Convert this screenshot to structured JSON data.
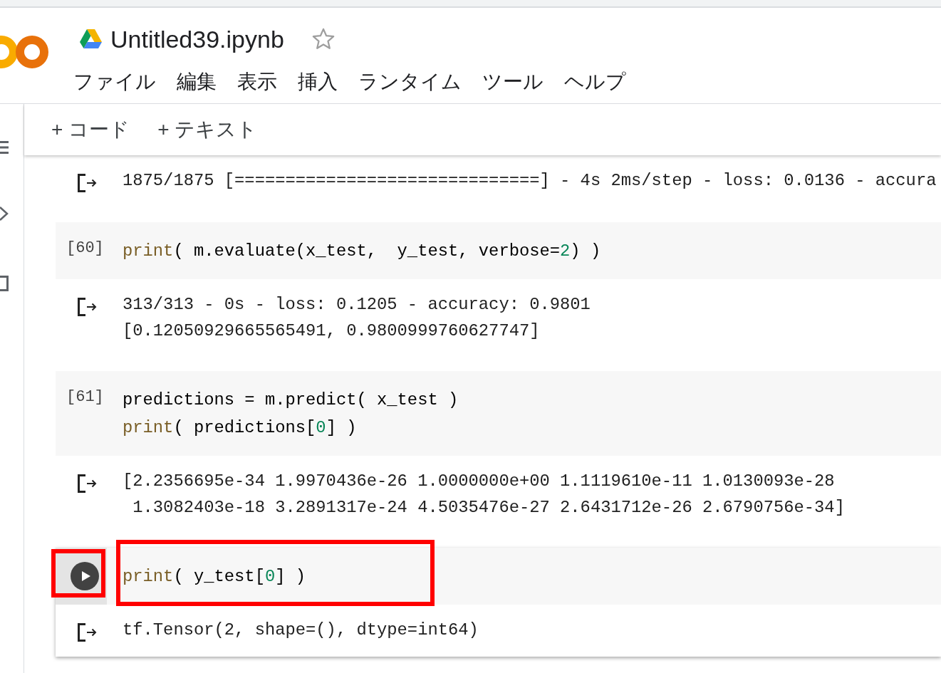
{
  "header": {
    "title": "Untitled39.ipynb",
    "starred": false,
    "menu": [
      "ファイル",
      "編集",
      "表示",
      "挿入",
      "ランタイム",
      "ツール",
      "ヘルプ"
    ]
  },
  "toolbar": {
    "buttons": [
      "+ コード",
      "+ テキスト"
    ]
  },
  "cells": [
    {
      "kind": "output_only",
      "output": [
        "1875/1875 [==============================] - 4s 2ms/step - loss: 0.0136 - accura"
      ]
    },
    {
      "kind": "code",
      "prompt": "[60]",
      "focused": false,
      "code": [
        [
          {
            "kind": "builtin",
            "text": "print"
          },
          {
            "kind": "plain",
            "text": "( m.evaluate(x_test,  y_test, verbose="
          },
          {
            "kind": "number",
            "text": "2"
          },
          {
            "kind": "plain",
            "text": ") )"
          }
        ]
      ],
      "output": [
        "313/313 - 0s - loss: 0.1205 - accuracy: 0.9801",
        "[0.12050929665565491, 0.9800999760627747]"
      ]
    },
    {
      "kind": "code",
      "prompt": "[61]",
      "focused": false,
      "code": [
        [
          {
            "kind": "plain",
            "text": "predictions = m.predict( x_test )"
          }
        ],
        [
          {
            "kind": "builtin",
            "text": "print"
          },
          {
            "kind": "plain",
            "text": "( predictions["
          },
          {
            "kind": "number",
            "text": "0"
          },
          {
            "kind": "plain",
            "text": "] )"
          }
        ]
      ],
      "output": [
        "[2.2356695e-34 1.9970436e-26 1.0000000e+00 1.1119610e-11 1.0130093e-28",
        " 1.3082403e-18 3.2891317e-24 4.5035476e-27 2.6431712e-26 2.6790756e-34]"
      ]
    },
    {
      "kind": "code",
      "focused": true,
      "highlight": {
        "run_button": true,
        "code": true
      },
      "code": [
        [
          {
            "kind": "builtin",
            "text": "print"
          },
          {
            "kind": "plain",
            "text": "( y_test["
          },
          {
            "kind": "number",
            "text": "0"
          },
          {
            "kind": "plain",
            "text": "] )"
          }
        ]
      ],
      "output": [
        "tf.Tensor(2, shape=(), dtype=int64)"
      ]
    }
  ]
}
